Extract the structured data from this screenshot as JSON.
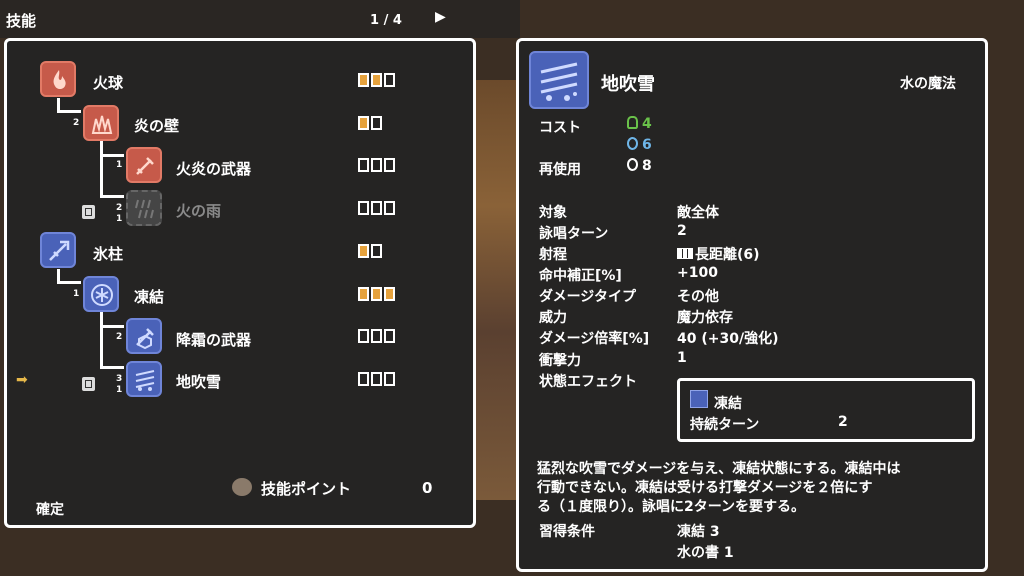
{
  "header": {
    "title": "技能",
    "page": "1 / 4",
    "next_icon": "▶"
  },
  "tree": {
    "skills": [
      {
        "id": "fireball",
        "name": "火球",
        "element": "fire",
        "pips": [
          1,
          1,
          0
        ]
      },
      {
        "id": "firewall",
        "name": "炎の壁",
        "element": "fire",
        "req": "2",
        "pips": [
          1,
          0
        ]
      },
      {
        "id": "fireweapon",
        "name": "火炎の武器",
        "element": "fire",
        "req": "1",
        "pips": [
          0,
          0,
          0
        ]
      },
      {
        "id": "firerain",
        "name": "火の雨",
        "element": "locked",
        "req": "2",
        "book_req": "1",
        "pips": [
          0,
          0,
          0
        ]
      },
      {
        "id": "icepillar",
        "name": "氷柱",
        "element": "ice",
        "pips": [
          1,
          0
        ]
      },
      {
        "id": "freeze",
        "name": "凍結",
        "element": "ice",
        "req": "1",
        "pips": [
          1,
          1,
          1
        ]
      },
      {
        "id": "frostweapon",
        "name": "降霜の武器",
        "element": "ice",
        "req": "2",
        "pips": [
          0,
          0,
          0
        ]
      },
      {
        "id": "blizzard",
        "name": "地吹雪",
        "element": "ice",
        "req": "3",
        "book_req": "1",
        "pips": [
          0,
          0,
          0
        ]
      }
    ],
    "cursor_icon": "➡",
    "skill_points_label": "技能ポイント",
    "skill_points_value": "0",
    "confirm_label": "確定"
  },
  "detail": {
    "name": "地吹雪",
    "school": "水の魔法",
    "cost_label": "コスト",
    "cost_stamina": "4",
    "cost_mana": "6",
    "cooldown_label": "再使用",
    "cooldown_value": "8",
    "stats": [
      {
        "label": "対象",
        "value": "敵全体"
      },
      {
        "label": "詠唱ターン",
        "value": "2"
      },
      {
        "label": "射程",
        "value": "長距離(6)"
      },
      {
        "label": "命中補正[%]",
        "value": "+100"
      },
      {
        "label": "ダメージタイプ",
        "value": "その他"
      },
      {
        "label": "威力",
        "value": "魔力依存"
      },
      {
        "label": "ダメージ倍率[%]",
        "value": "40 (+30/強化)"
      },
      {
        "label": "衝撃力",
        "value": "1"
      }
    ],
    "effect_label": "状態エフェクト",
    "effect": {
      "name": "凍結",
      "duration_label": "持続ターン",
      "duration_value": "2"
    },
    "description": [
      "猛烈な吹雪でダメージを与え、凍結状態にする。凍結中は",
      "行動できない。凍結は受ける打撃ダメージを２倍にす",
      "る（１度限り）。詠唱に2ターンを要する。"
    ],
    "requirements_label": "習得条件",
    "requirements": [
      "凍結 3",
      "水の書 1"
    ]
  },
  "colors": {
    "fire": "#c65a4a",
    "ice": "#4a62b8",
    "pip_on": "#e6a23c",
    "stamina": "#6ac24a",
    "mana": "#6fb6e8"
  }
}
